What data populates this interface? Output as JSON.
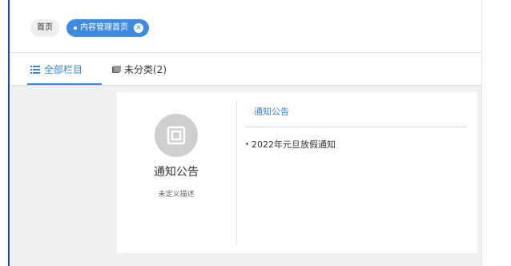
{
  "tags": {
    "home_label": "首页",
    "active_label": "内容管理首页",
    "close_symbol": "✕"
  },
  "tabs": [
    {
      "label": "全部栏目",
      "icon": "list-icon",
      "active": true
    },
    {
      "label": "未分类(2)",
      "icon": "folder-icon",
      "active": false
    }
  ],
  "card": {
    "title": "通知公告",
    "description": "未定义描述",
    "icon": "document-icon",
    "section_heading": "通知公告",
    "items": [
      "2022年元旦放假通知"
    ]
  },
  "colors": {
    "accent": "#3a86d6",
    "active_tag": "#3f8be0",
    "left_bar": "#1f4e9a"
  }
}
